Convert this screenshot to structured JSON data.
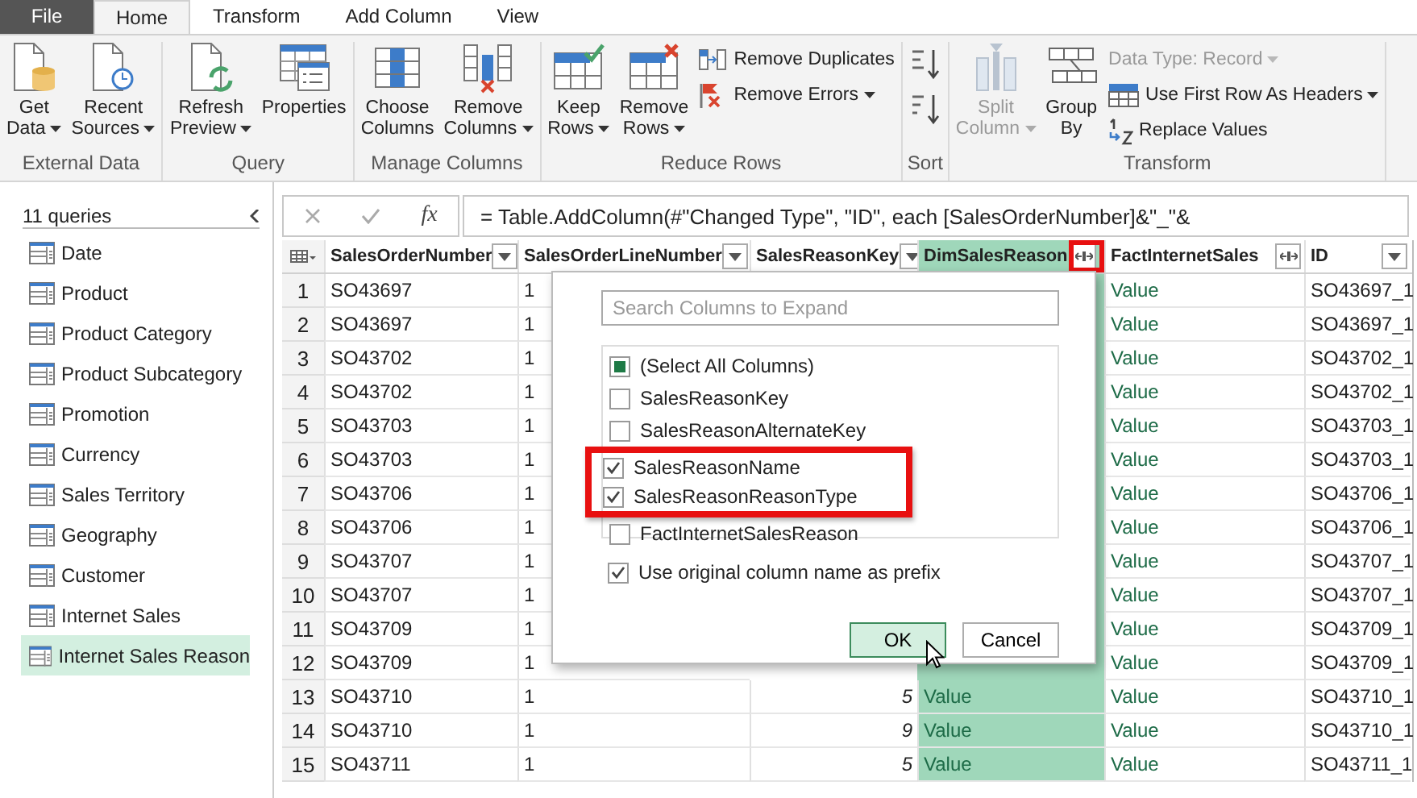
{
  "tabs": [
    {
      "label": "File",
      "kind": "file",
      "selected": false
    },
    {
      "label": "Home",
      "kind": "tab",
      "selected": true
    },
    {
      "label": "Transform",
      "kind": "tab",
      "selected": false
    },
    {
      "label": "Add Column",
      "kind": "tab",
      "selected": false
    },
    {
      "label": "View",
      "kind": "tab",
      "selected": false
    }
  ],
  "ribbon": {
    "groups": [
      {
        "label": "External Data",
        "items": [
          {
            "kind": "large",
            "lines": [
              "Get",
              "Data"
            ],
            "dropdown": true,
            "disabled": false
          },
          {
            "kind": "large",
            "lines": [
              "Recent",
              "Sources"
            ],
            "dropdown": true,
            "disabled": false
          }
        ]
      },
      {
        "label": "Query",
        "items": [
          {
            "kind": "large",
            "lines": [
              "Refresh",
              "Preview"
            ],
            "dropdown": true,
            "disabled": false
          },
          {
            "kind": "large",
            "lines": [
              "Properties"
            ],
            "dropdown": false,
            "disabled": false
          }
        ]
      },
      {
        "label": "Manage Columns",
        "items": [
          {
            "kind": "large",
            "lines": [
              "Choose",
              "Columns"
            ],
            "dropdown": false,
            "disabled": false
          },
          {
            "kind": "large",
            "lines": [
              "Remove",
              "Columns"
            ],
            "dropdown": true,
            "disabled": false
          }
        ]
      },
      {
        "label": "Reduce Rows",
        "items": [
          {
            "kind": "large",
            "lines": [
              "Keep",
              "Rows"
            ],
            "dropdown": true,
            "disabled": false
          },
          {
            "kind": "large",
            "lines": [
              "Remove",
              "Rows"
            ],
            "dropdown": true,
            "disabled": false
          },
          {
            "kind": "small",
            "lines": [
              "Remove Duplicates"
            ],
            "dropdown": false,
            "disabled": false
          },
          {
            "kind": "small",
            "lines": [
              "Remove Errors"
            ],
            "dropdown": true,
            "disabled": false
          }
        ]
      },
      {
        "label": "Sort",
        "items": [
          {
            "kind": "icon",
            "dropdown": false,
            "disabled": false
          },
          {
            "kind": "icon",
            "dropdown": false,
            "disabled": false
          }
        ]
      },
      {
        "label": "Transform",
        "items": [
          {
            "kind": "large",
            "lines": [
              "Split",
              "Column"
            ],
            "dropdown": true,
            "disabled": true
          },
          {
            "kind": "large",
            "lines": [
              "Group",
              "By"
            ],
            "dropdown": false,
            "disabled": false
          },
          {
            "kind": "plain",
            "lines": [
              "Data Type: Record"
            ],
            "dropdown": true,
            "disabled": true
          },
          {
            "kind": "small",
            "lines": [
              "Use First Row As Headers"
            ],
            "dropdown": true,
            "disabled": false
          },
          {
            "kind": "small",
            "lines": [
              "Replace Values"
            ],
            "dropdown": false,
            "disabled": false
          }
        ]
      }
    ]
  },
  "queries": {
    "title": "11 queries",
    "items": [
      {
        "label": "Date",
        "selected": false
      },
      {
        "label": "Product",
        "selected": false
      },
      {
        "label": "Product Category",
        "selected": false
      },
      {
        "label": "Product Subcategory",
        "selected": false
      },
      {
        "label": "Promotion",
        "selected": false
      },
      {
        "label": "Currency",
        "selected": false
      },
      {
        "label": "Sales Territory",
        "selected": false
      },
      {
        "label": "Geography",
        "selected": false
      },
      {
        "label": "Customer",
        "selected": false
      },
      {
        "label": "Internet Sales",
        "selected": false
      },
      {
        "label": "Internet Sales Reason",
        "selected": true
      }
    ]
  },
  "formula_bar": {
    "fx": "fx",
    "formula": "= Table.AddColumn(#\"Changed Type\", \"ID\", each [SalesOrderNumber]&\"_\"&"
  },
  "table": {
    "columns": [
      {
        "name": "SalesOrderNumber",
        "kind": "filter",
        "selected": false,
        "highlighted": false
      },
      {
        "name": "SalesOrderLineNumber",
        "kind": "filter",
        "selected": false,
        "highlighted": false
      },
      {
        "name": "SalesReasonKey",
        "kind": "filter",
        "selected": false,
        "highlighted": false
      },
      {
        "name": "DimSalesReason",
        "kind": "expand",
        "selected": true,
        "highlighted": true
      },
      {
        "name": "FactInternetSales",
        "kind": "expand",
        "selected": false,
        "highlighted": false
      },
      {
        "name": "ID",
        "kind": "filter",
        "selected": false,
        "highlighted": false
      }
    ],
    "rows": [
      {
        "number": "1",
        "cells": [
          "SO43697",
          "1",
          null,
          null,
          "Value",
          "SO43697_1"
        ]
      },
      {
        "number": "2",
        "cells": [
          "SO43697",
          "1",
          null,
          null,
          "Value",
          "SO43697_1"
        ]
      },
      {
        "number": "3",
        "cells": [
          "SO43702",
          "1",
          null,
          null,
          "Value",
          "SO43702_1"
        ]
      },
      {
        "number": "4",
        "cells": [
          "SO43702",
          "1",
          null,
          null,
          "Value",
          "SO43702_1"
        ]
      },
      {
        "number": "5",
        "cells": [
          "SO43703",
          "1",
          null,
          null,
          "Value",
          "SO43703_1"
        ]
      },
      {
        "number": "6",
        "cells": [
          "SO43703",
          "1",
          null,
          null,
          "Value",
          "SO43703_1"
        ]
      },
      {
        "number": "7",
        "cells": [
          "SO43706",
          "1",
          null,
          null,
          "Value",
          "SO43706_1"
        ]
      },
      {
        "number": "8",
        "cells": [
          "SO43706",
          "1",
          null,
          null,
          "Value",
          "SO43706_1"
        ]
      },
      {
        "number": "9",
        "cells": [
          "SO43707",
          "1",
          null,
          null,
          "Value",
          "SO43707_1"
        ]
      },
      {
        "number": "10",
        "cells": [
          "SO43707",
          "1",
          null,
          null,
          "Value",
          "SO43707_1"
        ]
      },
      {
        "number": "11",
        "cells": [
          "SO43709",
          "1",
          null,
          null,
          "Value",
          "SO43709_1"
        ]
      },
      {
        "number": "12",
        "cells": [
          "SO43709",
          "1",
          null,
          null,
          "Value",
          "SO43709_1"
        ]
      },
      {
        "number": "13",
        "cells": [
          "SO43710",
          "1",
          "5",
          "Value",
          "Value",
          "SO43710_1"
        ]
      },
      {
        "number": "14",
        "cells": [
          "SO43710",
          "1",
          "9",
          "Value",
          "Value",
          "SO43710_1"
        ]
      },
      {
        "number": "15",
        "cells": [
          "SO43711",
          "1",
          "5",
          "Value",
          "Value",
          "SO43711_1"
        ]
      }
    ]
  },
  "expand_dialog": {
    "search": {
      "placeholder": "Search Columns to Expand"
    },
    "columns": [
      {
        "kind": "option",
        "label": "(Select All Columns)",
        "checked": false,
        "partial": true
      },
      {
        "kind": "option",
        "label": "SalesReasonKey",
        "checked": false
      },
      {
        "kind": "option",
        "label": "SalesReasonAlternateKey",
        "checked": false
      },
      {
        "kind": "highlight",
        "items": [
          {
            "label": "SalesReasonName",
            "checked": true
          },
          {
            "label": "SalesReasonReasonType",
            "checked": true
          }
        ]
      },
      {
        "kind": "option",
        "label": "FactInternetSalesReason",
        "checked": false
      }
    ],
    "prefix": {
      "label": "Use original column name as prefix",
      "checked": true
    },
    "buttons": [
      {
        "label": "OK",
        "kind": "primary"
      },
      {
        "label": "Cancel",
        "kind": "secondary"
      }
    ]
  }
}
